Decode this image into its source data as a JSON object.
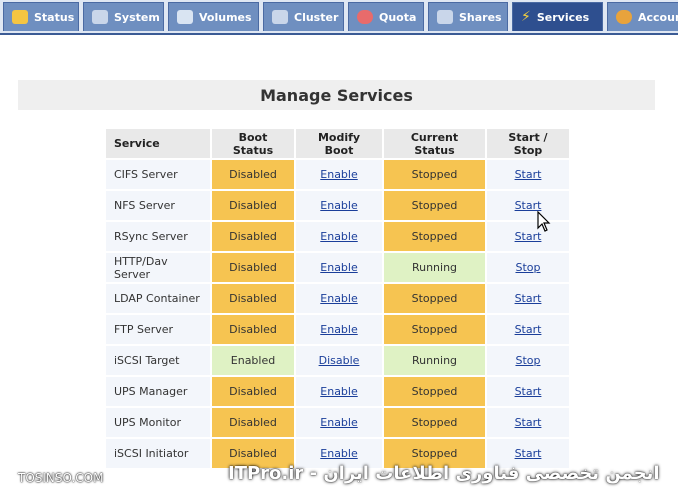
{
  "tabs": [
    {
      "label": "Status",
      "icon": "status-icon",
      "color": "#f5c542"
    },
    {
      "label": "System",
      "icon": "system-icon",
      "color": "#c9d6ea"
    },
    {
      "label": "Volumes",
      "icon": "volumes-icon",
      "color": "#d9e4f2"
    },
    {
      "label": "Cluster",
      "icon": "cluster-icon",
      "color": "#c9d6ea"
    },
    {
      "label": "Quota",
      "icon": "quota-icon",
      "color": "#e86b6b"
    },
    {
      "label": "Shares",
      "icon": "shares-icon",
      "color": "#c9d6ea"
    },
    {
      "label": "Services",
      "icon": "services-icon",
      "color": "#f7d23c",
      "active": true
    },
    {
      "label": "Accounts",
      "icon": "accounts-icon",
      "color": "#e8a33c"
    }
  ],
  "page_title": "Manage Services",
  "table": {
    "headers": [
      "Service",
      "Boot Status",
      "Modify Boot",
      "Current Status",
      "Start / Stop"
    ],
    "rows": [
      {
        "service": "CIFS Server",
        "boot": "Disabled",
        "modify": "Enable",
        "current": "Stopped",
        "action": "Start"
      },
      {
        "service": "NFS Server",
        "boot": "Disabled",
        "modify": "Enable",
        "current": "Stopped",
        "action": "Start"
      },
      {
        "service": "RSync Server",
        "boot": "Disabled",
        "modify": "Enable",
        "current": "Stopped",
        "action": "Start"
      },
      {
        "service": "HTTP/Dav Server",
        "boot": "Disabled",
        "modify": "Enable",
        "current": "Running",
        "action": "Stop"
      },
      {
        "service": "LDAP Container",
        "boot": "Disabled",
        "modify": "Enable",
        "current": "Stopped",
        "action": "Start"
      },
      {
        "service": "FTP Server",
        "boot": "Disabled",
        "modify": "Enable",
        "current": "Stopped",
        "action": "Start"
      },
      {
        "service": "iSCSI Target",
        "boot": "Enabled",
        "modify": "Disable",
        "current": "Running",
        "action": "Stop"
      },
      {
        "service": "UPS Manager",
        "boot": "Disabled",
        "modify": "Enable",
        "current": "Stopped",
        "action": "Start"
      },
      {
        "service": "UPS Monitor",
        "boot": "Disabled",
        "modify": "Enable",
        "current": "Stopped",
        "action": "Start"
      },
      {
        "service": "iSCSI Initiator",
        "boot": "Disabled",
        "modify": "Enable",
        "current": "Stopped",
        "action": "Start"
      }
    ]
  },
  "colors": {
    "disabled": "#f6c451",
    "enabled": "#dff2c4",
    "stopped": "#f6c451",
    "running": "#dff2c4",
    "link": "#1a3e9a",
    "tab_active": "#2e4f8f",
    "tab": "#6f8fc0"
  },
  "watermark": {
    "left": "TOSINSO.COM",
    "right": "ITPro.ir - انجمن تخصصی فناوری اطلاعات ایران"
  }
}
